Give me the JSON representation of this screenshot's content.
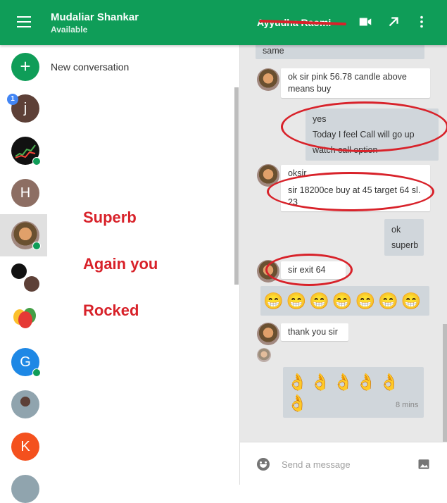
{
  "header": {
    "user_name": "Mudaliar Shankar",
    "user_status": "Available",
    "contact_name": "Ayyudha Raomi",
    "icons": [
      "menu-icon",
      "video-call-icon",
      "popout-icon",
      "more-vert-icon"
    ]
  },
  "sidebar": {
    "new_conversation": "New conversation",
    "contacts": [
      {
        "initial": "j",
        "color": "#5d4037",
        "badge": "1"
      },
      {
        "initial": "",
        "color": "#111111",
        "online": true
      },
      {
        "initial": "H",
        "color": "#8d6e63"
      },
      {
        "initial": "",
        "color": "#a1887f",
        "online": true,
        "selected": true
      },
      {
        "initial": "",
        "color": "#ffffff"
      },
      {
        "initial": "",
        "color": "#ffffff"
      },
      {
        "initial": "G",
        "color": "#1e88e5",
        "online": true
      },
      {
        "initial": "",
        "color": "#9e9e9e"
      },
      {
        "initial": "K",
        "color": "#f4511e"
      }
    ],
    "overlay_text": [
      "Superb",
      "Again you",
      "Rocked"
    ]
  },
  "chat": {
    "messages": [
      {
        "text": "same"
      },
      {
        "text": "ok sir pink 56.78 candle above means buy"
      },
      {
        "lines": [
          "yes",
          "Today I feel Call will go up",
          "watch call option"
        ]
      },
      {
        "lines": [
          "oksir",
          "sir 18200ce buy at 45 target 64 sl. 23"
        ]
      },
      {
        "lines": [
          "ok",
          "superb"
        ]
      },
      {
        "text": "sir exit 64"
      },
      {
        "emoji": "😁😁😁😁😁😁😁"
      },
      {
        "text": "thank you sir"
      },
      {
        "emoji": "👌👌👌👌👌👌"
      }
    ],
    "time": "8 mins"
  },
  "composer": {
    "placeholder": "Send a message"
  },
  "colors": {
    "accent": "#0f9d58",
    "annotation": "#d8222a",
    "chat_bg": "#e8e8e8"
  }
}
